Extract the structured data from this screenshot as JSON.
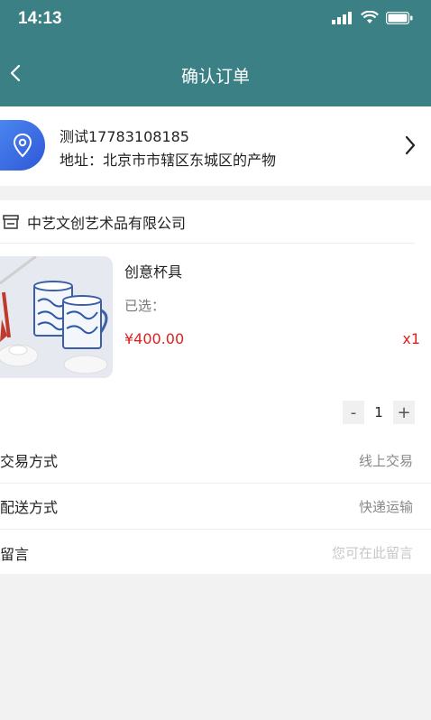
{
  "status_bar": {
    "time": "14:13"
  },
  "header": {
    "title": "确认订单"
  },
  "address": {
    "name_phone": "测试17783108185",
    "address_line": "地址：北京市市辖区东城区的产物"
  },
  "shop": {
    "name": "中艺文创艺术品有限公司"
  },
  "product": {
    "title": "创意杯具",
    "spec": "已选：",
    "price": "¥400.00",
    "quantity_label": "x1"
  },
  "stepper": {
    "minus": "-",
    "value": "1",
    "plus": "+"
  },
  "fields": {
    "trade_label": "交易方式",
    "trade_value": "线上交易",
    "delivery_label": "配送方式",
    "delivery_value": "快递运输",
    "message_label": "留言",
    "message_placeholder": "您可在此留言"
  },
  "colors": {
    "header_bg": "#3a8084",
    "price": "#e02020",
    "location_icon": "#3b6fe3"
  }
}
